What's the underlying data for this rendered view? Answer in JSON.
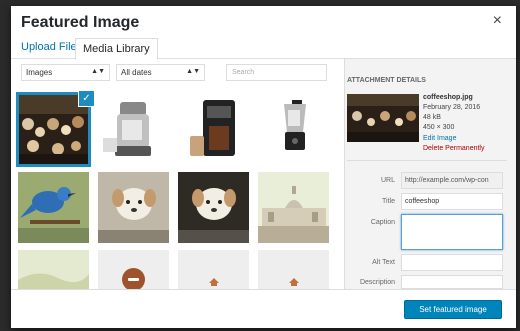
{
  "modal": {
    "title": "Featured Image",
    "close_icon": "×"
  },
  "tabs": [
    {
      "label": "Upload Files",
      "active": false
    },
    {
      "label": "Media Library",
      "active": true
    }
  ],
  "toolbar": {
    "filter_type": "Images",
    "filter_date": "All dates",
    "search_placeholder": "Search"
  },
  "grid": {
    "items": [
      {
        "name": "coffeeshop",
        "selected": true
      },
      {
        "name": "juicer"
      },
      {
        "name": "coffee-maker"
      },
      {
        "name": "blender"
      },
      {
        "name": "bluebird"
      },
      {
        "name": "puppy"
      },
      {
        "name": "puppy-2"
      },
      {
        "name": "city-dome"
      },
      {
        "name": "landscape"
      },
      {
        "name": "document-file"
      },
      {
        "name": "generic-file"
      },
      {
        "name": "generic-file-2"
      }
    ]
  },
  "sidebar": {
    "heading": "ATTACHMENT DETAILS",
    "filename": "coffeeshop.jpg",
    "date": "February 28, 2016",
    "size": "48 kB",
    "dimensions": "450 × 300",
    "edit_link": "Edit Image",
    "delete_link": "Delete Permanently",
    "fields": {
      "url_label": "URL",
      "url_value": "http://example.com/wp-con",
      "title_label": "Title",
      "title_value": "coffeeshop",
      "caption_label": "Caption",
      "caption_value": "",
      "alt_label": "Alt Text",
      "alt_value": "",
      "desc_label": "Description",
      "desc_value": ""
    }
  },
  "footer": {
    "button_label": "Set featured image"
  },
  "colors": {
    "accent": "#0073aa",
    "primary_button": "#0085ba",
    "selection": "#1e8cbe",
    "danger": "#aa0000"
  }
}
